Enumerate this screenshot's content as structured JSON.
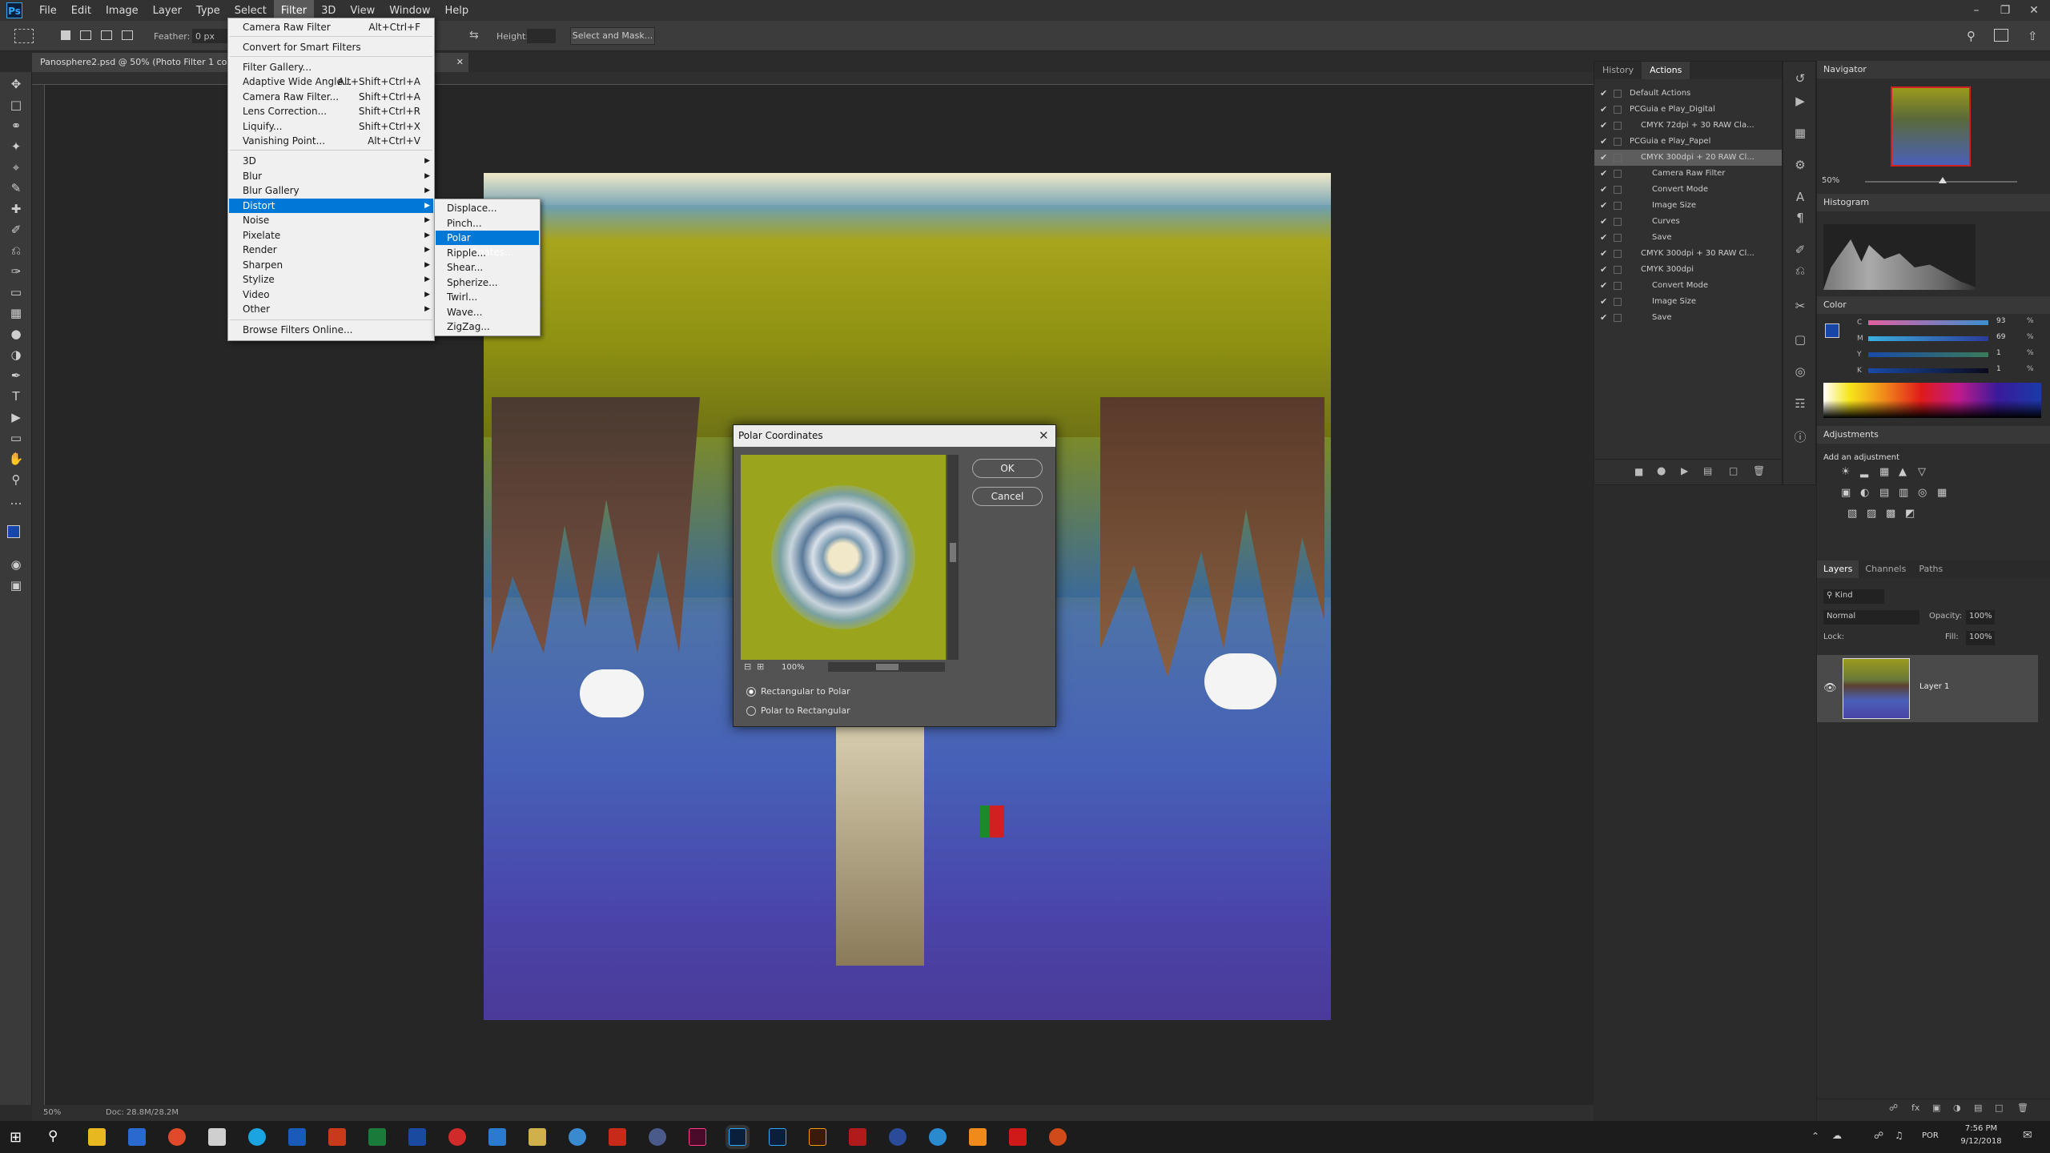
{
  "menubar": [
    "File",
    "Edit",
    "Image",
    "Layer",
    "Type",
    "Select",
    "Filter",
    "3D",
    "View",
    "Window",
    "Help"
  ],
  "optionsbar": {
    "feather_label": "Feather:",
    "feather_value": "0 px",
    "height_label": "Height:",
    "select_mask": "Select and Mask..."
  },
  "document_tab": "Panosphere2.psd @ 50% (Photo Filter 1 copy...",
  "filter_menu": [
    {
      "label": "Camera Raw Filter",
      "shortcut": "Alt+Ctrl+F"
    },
    {
      "label": "Convert for Smart Filters",
      "shortcut": ""
    },
    {
      "label": "Filter Gallery...",
      "shortcut": ""
    },
    {
      "label": "Adaptive Wide Angle...",
      "shortcut": "Alt+Shift+Ctrl+A"
    },
    {
      "label": "Camera Raw Filter...",
      "shortcut": "Shift+Ctrl+A"
    },
    {
      "label": "Lens Correction...",
      "shortcut": "Shift+Ctrl+R"
    },
    {
      "label": "Liquify...",
      "shortcut": "Shift+Ctrl+X"
    },
    {
      "label": "Vanishing Point...",
      "shortcut": "Alt+Ctrl+V"
    },
    {
      "label": "3D",
      "shortcut": ""
    },
    {
      "label": "Blur",
      "shortcut": ""
    },
    {
      "label": "Blur Gallery",
      "shortcut": ""
    },
    {
      "label": "Distort",
      "shortcut": ""
    },
    {
      "label": "Noise",
      "shortcut": ""
    },
    {
      "label": "Pixelate",
      "shortcut": ""
    },
    {
      "label": "Render",
      "shortcut": ""
    },
    {
      "label": "Sharpen",
      "shortcut": ""
    },
    {
      "label": "Stylize",
      "shortcut": ""
    },
    {
      "label": "Video",
      "shortcut": ""
    },
    {
      "label": "Other",
      "shortcut": ""
    },
    {
      "label": "Browse Filters Online...",
      "shortcut": ""
    }
  ],
  "distort_submenu": [
    "Displace...",
    "Pinch...",
    "Polar Coordinates...",
    "Ripple...",
    "Shear...",
    "Spherize...",
    "Twirl...",
    "Wave...",
    "ZigZag..."
  ],
  "dialog": {
    "title": "Polar Coordinates",
    "ok": "OK",
    "cancel": "Cancel",
    "zoom": "100%",
    "options": [
      "Rectangular to Polar",
      "Polar to Rectangular"
    ],
    "selected_option": "Rectangular to Polar"
  },
  "history_tabs": [
    "History",
    "Actions"
  ],
  "actions": [
    {
      "label": "Default Actions",
      "level": 0
    },
    {
      "label": "PCGuia e Play_Digital",
      "level": 0
    },
    {
      "label": "CMYK 72dpi + 30 RAW Cla...",
      "level": 1
    },
    {
      "label": "PCGuia e Play_Papel",
      "level": 0
    },
    {
      "label": "CMYK 300dpi + 20 RAW Cl...",
      "level": 1
    },
    {
      "label": "Camera Raw Filter",
      "level": 2
    },
    {
      "label": "Convert Mode",
      "level": 2
    },
    {
      "label": "Image Size",
      "level": 2
    },
    {
      "label": "Curves",
      "level": 2
    },
    {
      "label": "Save",
      "level": 2
    },
    {
      "label": "CMYK 300dpi + 30 RAW Cl...",
      "level": 1
    },
    {
      "label": "CMYK 300dpi",
      "level": 1
    },
    {
      "label": "Convert Mode",
      "level": 2
    },
    {
      "label": "Image Size",
      "level": 2
    },
    {
      "label": "Save",
      "level": 2
    }
  ],
  "navigator": {
    "title": "Navigator",
    "zoom": "50%"
  },
  "histogram": {
    "title": "Histogram"
  },
  "color": {
    "title": "Color",
    "channels": [
      {
        "name": "C",
        "value": "93",
        "unit": "%"
      },
      {
        "name": "M",
        "value": "69",
        "unit": "%"
      },
      {
        "name": "Y",
        "value": "1",
        "unit": "%"
      },
      {
        "name": "K",
        "value": "1",
        "unit": "%"
      }
    ]
  },
  "adjustments": {
    "title": "Adjustments",
    "subtitle": "Add an adjustment"
  },
  "layers": {
    "tabs": [
      "Layers",
      "Channels",
      "Paths"
    ],
    "kind": "Kind",
    "blend": "Normal",
    "opacity_label": "Opacity:",
    "opacity": "100%",
    "lock_label": "Lock:",
    "fill_label": "Fill:",
    "fill": "100%",
    "layer_name": "Layer 1"
  },
  "statusbar": {
    "zoom": "50%",
    "doc": "Doc: 28.8M/28.2M"
  },
  "taskbar": {
    "time": "7:56 PM",
    "date": "9/12/2018",
    "lang": "POR"
  },
  "colors": {
    "accent": "#0078d7",
    "ps_blue": "#31a8ff",
    "fg_swatch": "#1546a8"
  }
}
